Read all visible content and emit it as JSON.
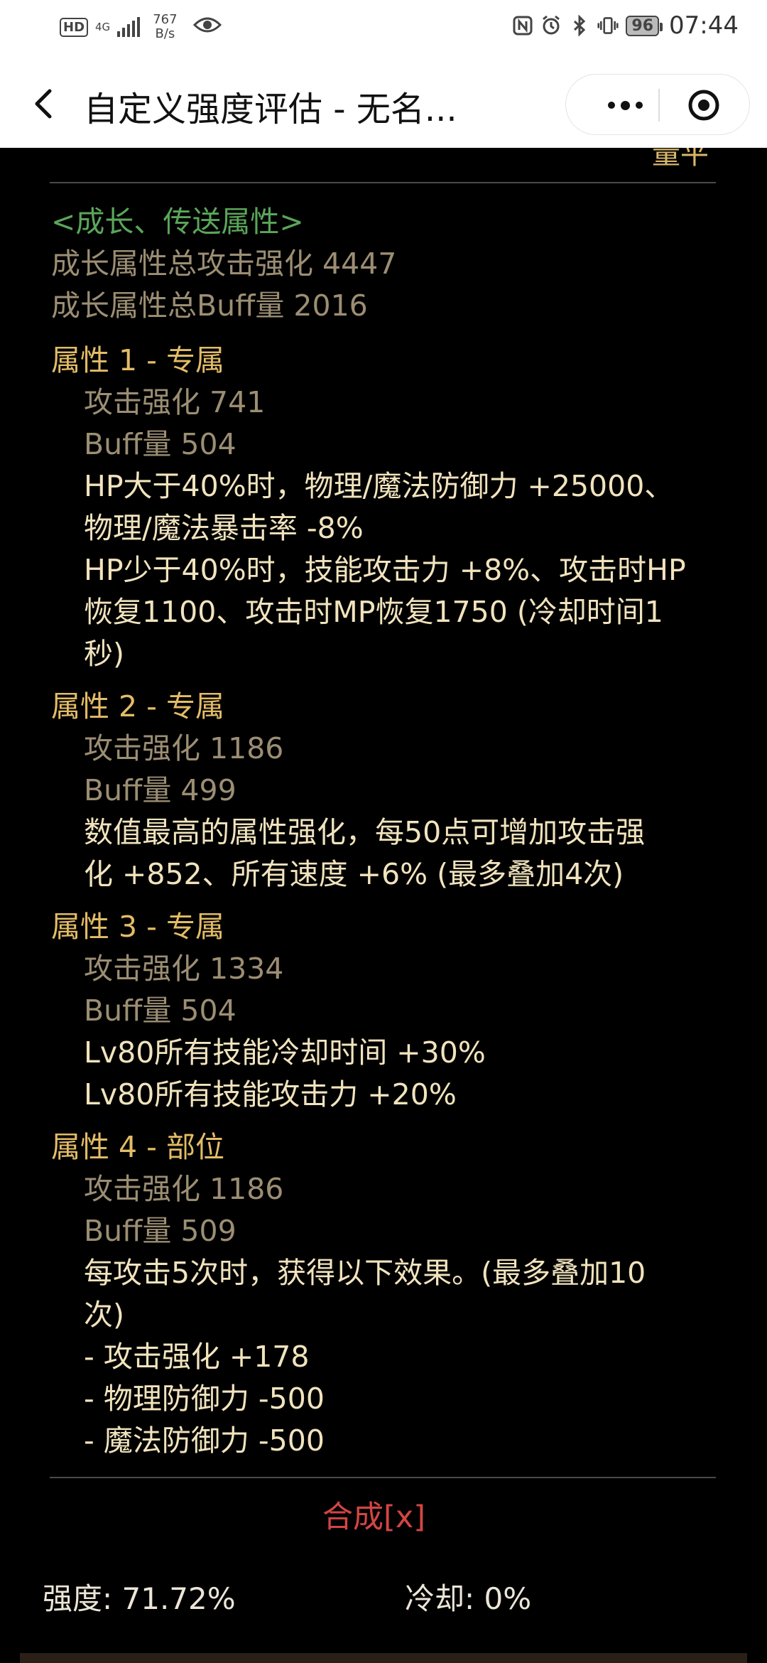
{
  "status_bar": {
    "hd_badge": "HD",
    "network": "4G",
    "net_speed_value": "767",
    "net_speed_unit": "B/s",
    "battery": "96",
    "time": "07:44"
  },
  "title_bar": {
    "title": "自定义强度评估 - 无名..."
  },
  "growth": {
    "header": "<成长、传送属性>",
    "total_attack": "成长属性总攻击强化 4447",
    "total_buff": "成长属性总Buff量 2016"
  },
  "attr1": {
    "header": "属性 1 - 专属",
    "attack": "攻击强化  741",
    "buff": "Buff量  504",
    "desc": [
      "HP大于40%时，物理/魔法防御力 +25000、",
      "物理/魔法暴击率 -8%",
      "HP少于40%时，技能攻击力 +8%、攻击时HP",
      "恢复1100、攻击时MP恢复1750 (冷却时间1",
      "秒)"
    ]
  },
  "attr2": {
    "header": "属性 2 - 专属",
    "attack": "攻击强化  1186",
    "buff": "Buff量  499",
    "desc": [
      "数值最高的属性强化，每50点可增加攻击强",
      "化 +852、所有速度 +6% (最多叠加4次)"
    ]
  },
  "attr3": {
    "header": "属性 3 - 专属",
    "attack": "攻击强化  1334",
    "buff": "Buff量  504",
    "desc": [
      "Lv80所有技能冷却时间 +30%",
      "Lv80所有技能攻击力 +20%"
    ]
  },
  "attr4": {
    "header": "属性 4 - 部位",
    "attack": "攻击强化  1186",
    "buff": "Buff量  509",
    "desc": [
      "每攻击5次时，获得以下效果。(最多叠加10",
      "次)",
      "- 攻击强化 +178",
      "- 物理防御力 -500",
      "- 魔法防御力 -500"
    ]
  },
  "synth_button": "合成[x]",
  "summary": {
    "strength": "强度: 71.72%",
    "cooldown": "冷却: 0%"
  },
  "colors": {
    "background": "#000000",
    "green_header": "#5aa65a",
    "muted": "#9c8e73",
    "gold": "#e3bc66",
    "cream": "#f1e3bd",
    "red": "#d34545"
  }
}
